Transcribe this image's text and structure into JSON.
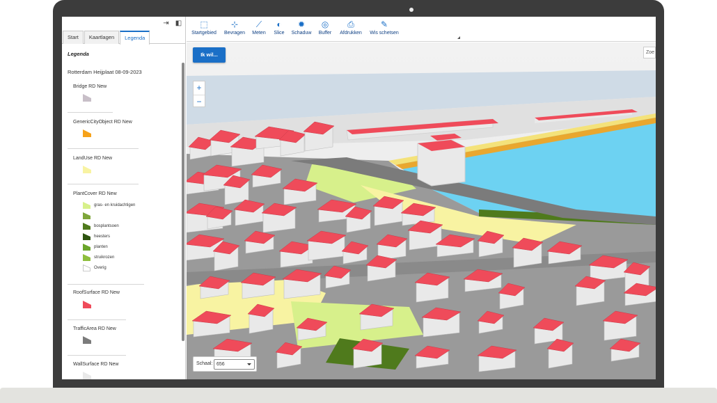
{
  "sidebar": {
    "icons": [
      "collapse-icon",
      "dock-icon"
    ],
    "tabs": [
      {
        "label": "Start",
        "active": false
      },
      {
        "label": "Kaartlagen",
        "active": false
      },
      {
        "label": "Legenda",
        "active": true
      }
    ],
    "legend": {
      "title": "Legenda",
      "dataset": "Rotterdam Heijplaat 08-09-2023",
      "layers": [
        {
          "name": "Bridge RD New",
          "color": "#c8bfc8"
        },
        {
          "name": "GenericCityObject RD New",
          "color": "#f6a21a"
        },
        {
          "name": "LandUse RD New",
          "color": "#f8f3a2"
        },
        {
          "name": "PlantCover RD New",
          "color": null
        },
        {
          "name": "RoofSurface RD New",
          "color": "#ef4b5a"
        },
        {
          "name": "TrafficArea RD New",
          "color": "#7b7b7b"
        },
        {
          "name": "WallSurface RD New",
          "color": "#e9e9e9"
        }
      ],
      "plantcover_classes": [
        {
          "label": "gras- en kruidachtigen",
          "color": "#d7f08b"
        },
        {
          "label": "",
          "color": "#7ea63a"
        },
        {
          "label": "bosplantsoen",
          "color": "#4f7a1c"
        },
        {
          "label": "heesters",
          "color": "#2e5410"
        },
        {
          "label": "planten",
          "color": "#6aa52a"
        },
        {
          "label": "struikrozen",
          "color": "#8fbf3e"
        },
        {
          "label": "Overig",
          "color": "#ffffff"
        }
      ]
    }
  },
  "toolbar": {
    "tools": [
      {
        "label": "Startgebied",
        "icon": "home-area-icon"
      },
      {
        "label": "Bevragen",
        "icon": "query-info-icon"
      },
      {
        "label": "Meten",
        "icon": "measure-icon"
      },
      {
        "label": "Slice",
        "icon": "slice-icon"
      },
      {
        "label": "Schaduw",
        "icon": "sun-shadow-icon"
      },
      {
        "label": "Buffer",
        "icon": "buffer-icon"
      },
      {
        "label": "Afdrukken",
        "icon": "printer-icon"
      },
      {
        "label": "Wis schetsen",
        "icon": "erase-sketch-icon"
      }
    ]
  },
  "map": {
    "ikwil_label": "Ik wil...",
    "zoom_in": "+",
    "zoom_out": "−",
    "search_placeholder": "Zoe",
    "scale_label": "Schaal:",
    "scale_value": "656"
  },
  "colors": {
    "accent": "#1a6fc7",
    "roof": "#ef4b5a",
    "wall": "#e9e9e9",
    "water": "#6dd2f2",
    "road": "#7b7b7b",
    "landuse": "#f8f3a2",
    "grass": "#d7f08b"
  }
}
